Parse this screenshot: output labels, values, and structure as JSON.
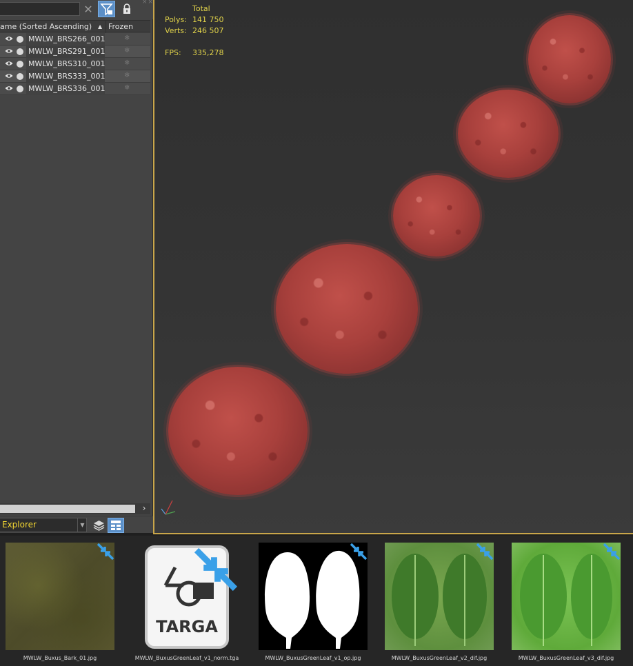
{
  "explorer": {
    "search": {
      "value": "",
      "placeholder": ""
    },
    "columns": {
      "name": "ame (Sorted Ascending)",
      "frozen": "Frozen"
    },
    "rows": [
      {
        "name": "MWLW_BRS266_001"
      },
      {
        "name": "MWLW_BRS291_001"
      },
      {
        "name": "MWLW_BRS310_001"
      },
      {
        "name": "MWLW_BRS333_001"
      },
      {
        "name": "MWLW_BRS336_001"
      }
    ],
    "mode_label": "Explorer"
  },
  "viewport": {
    "stats": {
      "total_label": "Total",
      "polys_label": "Polys:",
      "polys_value": "141 750",
      "verts_label": "Verts:",
      "verts_value": "246 507",
      "fps_label": "FPS:",
      "fps_value": "335,278"
    },
    "colors": {
      "shrub": "#b04440",
      "stats_text": "#e0d24a",
      "active_border": "#c9a64a"
    }
  },
  "textures": [
    {
      "filename": "MWLW_Buxus_Bark_01.jpg"
    },
    {
      "filename": "MWLW_BuxusGreenLeaf_v1_norm.tga",
      "badge_text": "TARGA"
    },
    {
      "filename": "MWLW_BuxusGreenLeaf_v1_op.jpg"
    },
    {
      "filename": "MWLW_BuxusGreenLeaf_v2_dif.jpg"
    },
    {
      "filename": "MWLW_BuxusGreenLeaf_v3_dif.jpg"
    }
  ],
  "icons": {
    "toolbar": [
      "search-clear-icon",
      "filter-icon",
      "lock-icon"
    ],
    "footer": [
      "layers-icon",
      "hierarchy-icon"
    ],
    "texture_badge": "shrink-arrows-icon"
  }
}
